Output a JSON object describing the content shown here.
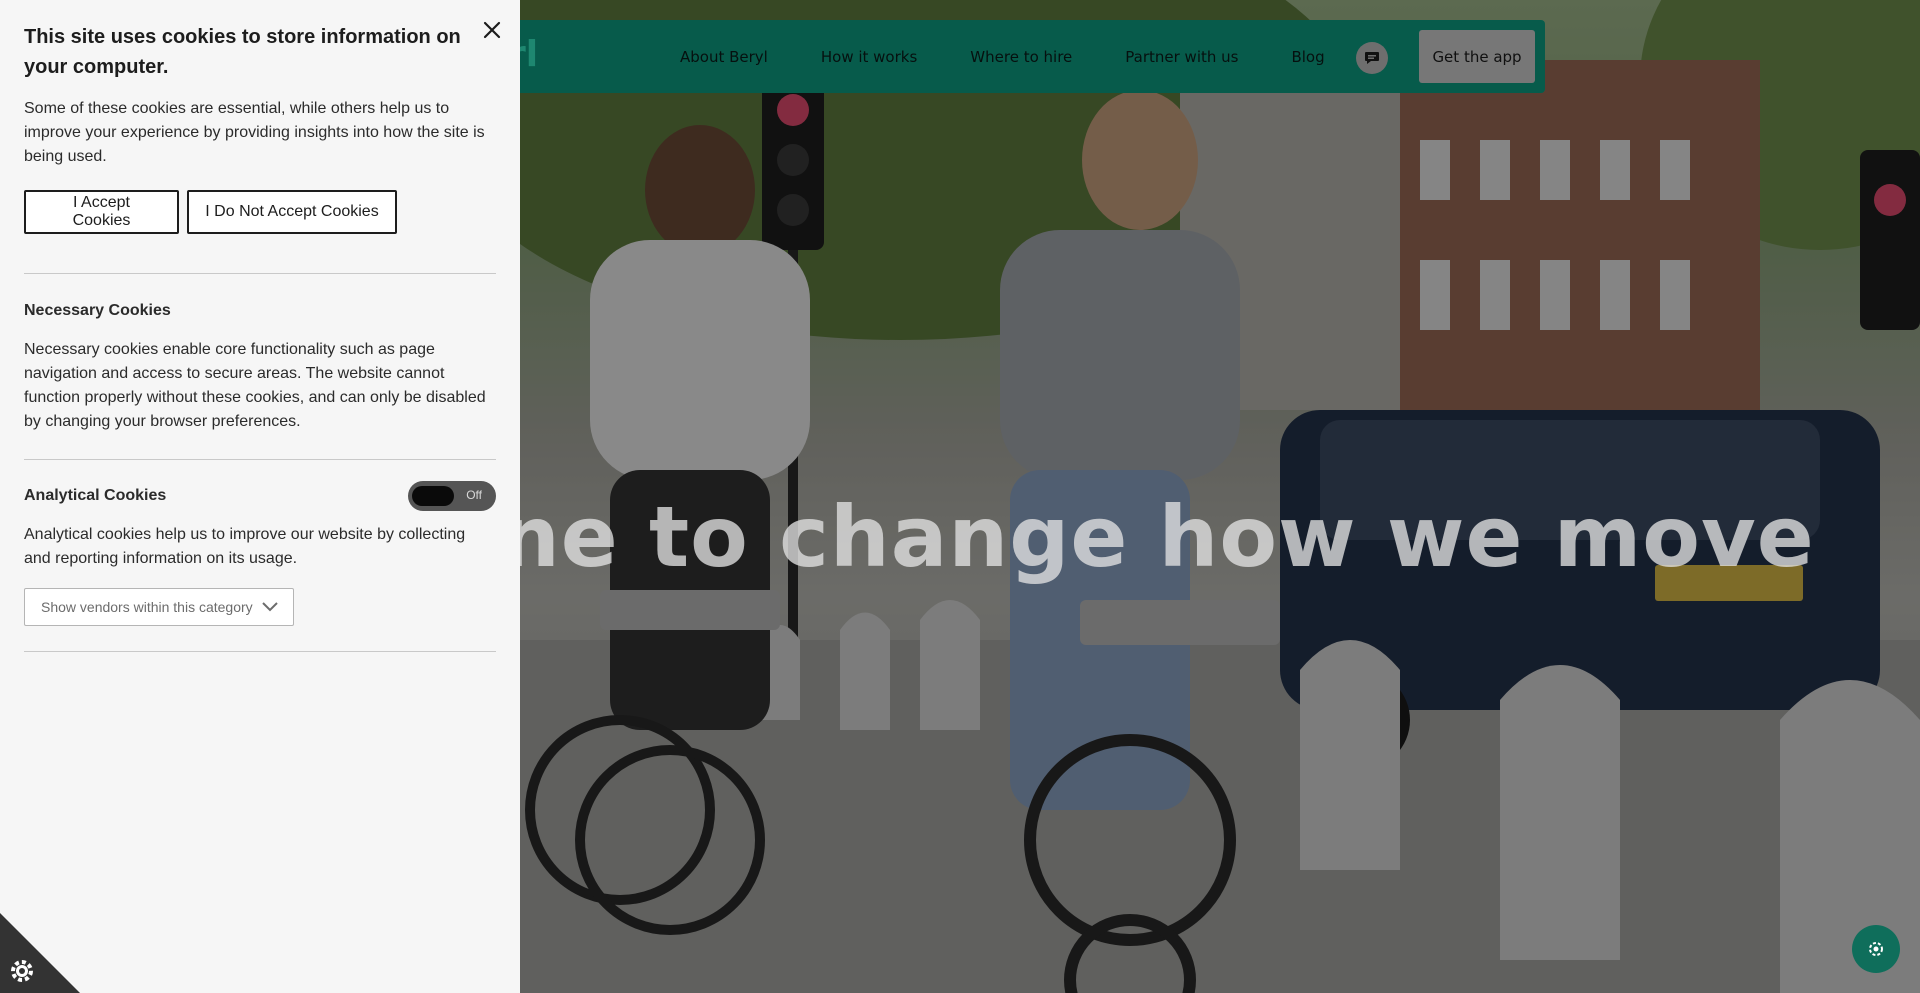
{
  "colors": {
    "brand": "#0c8d73",
    "logo": "#2fd0ad",
    "panel_bg": "#f6f6f6",
    "help_button": "#0f6e5b"
  },
  "navbar": {
    "logo_text": "rl",
    "links": [
      "About Beryl",
      "How it works",
      "Where to hire",
      "Partner with us",
      "Blog"
    ],
    "chat_icon": "chat-bubble-icon",
    "cta_label": "Get the app"
  },
  "hero": {
    "headline": "ne to change how we move"
  },
  "cookie_panel": {
    "title": "This site uses cookies to store information on your computer.",
    "intro": "Some of these cookies are essential, while others help us to improve your experience by providing insights into how the site is being used.",
    "accept_label": "I Accept Cookies",
    "reject_label": "I Do Not Accept Cookies",
    "necessary": {
      "heading": "Necessary Cookies",
      "text": "Necessary cookies enable core functionality such as page navigation and access to secure areas. The website cannot function properly without these cookies, and can only be disabled by changing your browser preferences."
    },
    "analytical": {
      "heading": "Analytical Cookies",
      "toggle_state": "Off",
      "text": "Analytical cookies help us to improve our website by collecting and reporting information on its usage.",
      "vendors_label": "Show vendors within this category"
    }
  }
}
